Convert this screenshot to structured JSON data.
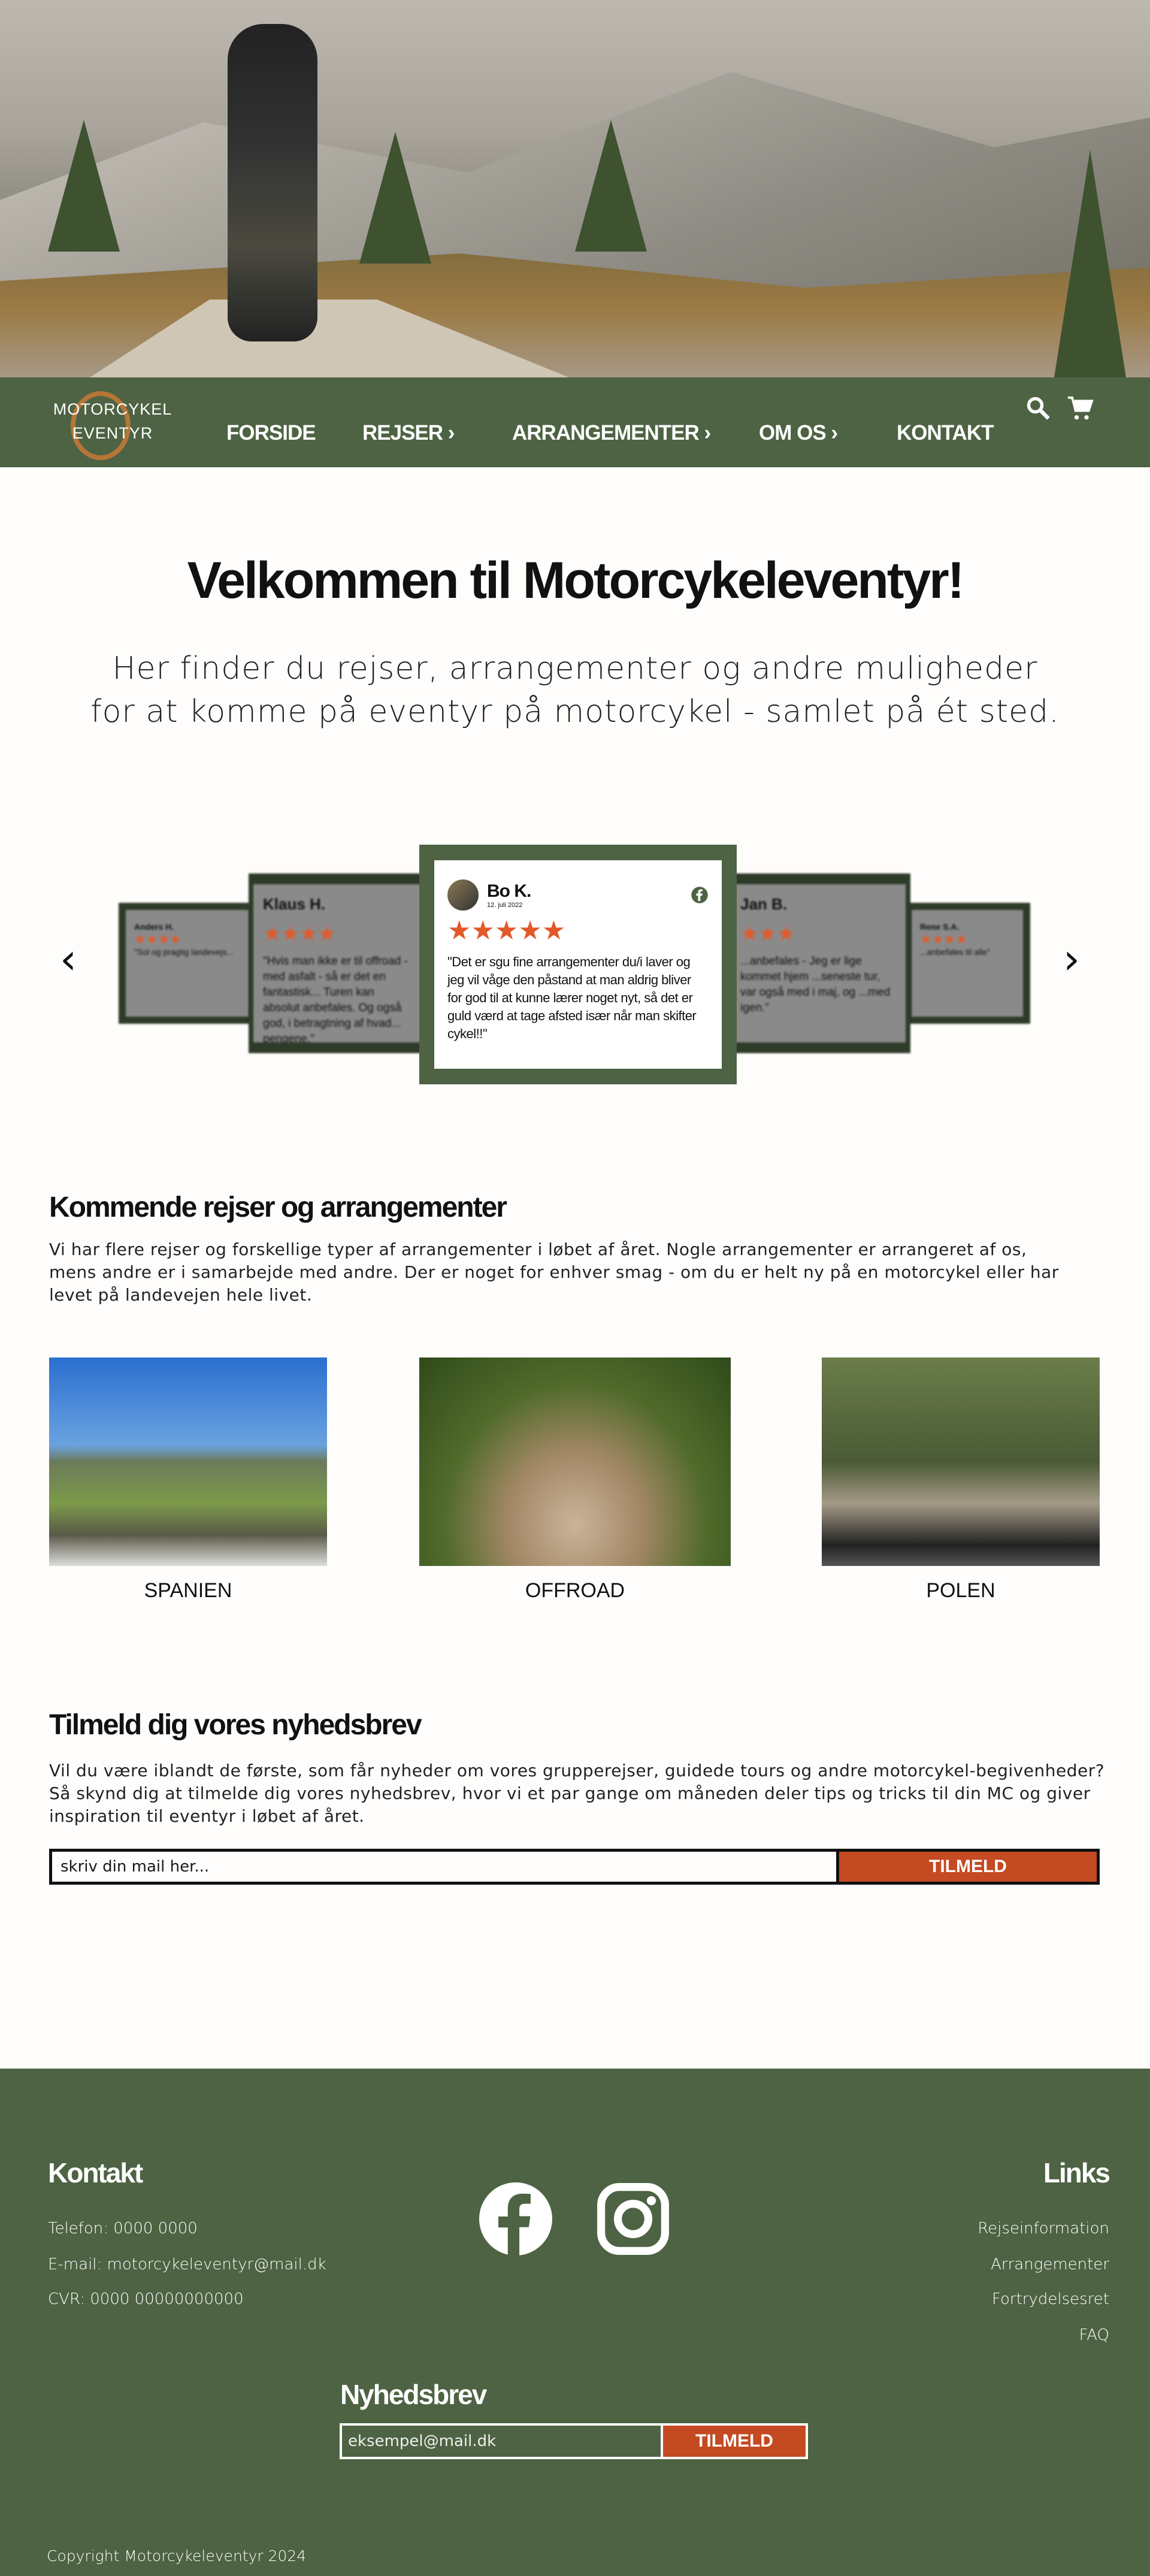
{
  "nav": {
    "logo_line1": "MOTORCYKEL",
    "logo_line2": "EVENTYR",
    "items": [
      {
        "label": "FORSIDE",
        "chevron": false
      },
      {
        "label": "REJSER",
        "chevron": true
      },
      {
        "label": "ARRANGEMENTER",
        "chevron": true
      },
      {
        "label": "OM OS",
        "chevron": true
      },
      {
        "label": "KONTAKT",
        "chevron": false
      }
    ],
    "icons": [
      "search-icon",
      "cart-icon"
    ]
  },
  "hero": {
    "title": "Velkommen til Motorcykeleventyr!",
    "subtitle_line1": "Her finder du rejser, arrangementer og andre muligheder",
    "subtitle_line2": "for at komme på eventyr på motorcykel - samlet på ét sted."
  },
  "reviews": [
    {
      "name": "Anders H.",
      "date": "",
      "stars": 4,
      "text": "\"Sol og pragtig landevejs..."
    },
    {
      "name": "Klaus H.",
      "date": "",
      "stars": 4,
      "text": "\"Hvis man ikke er til offroad - med asfalt - så er det en fantastisk... Turen kan absolut anbefales. Og også god, i betragtning af hvad... pengene.\""
    },
    {
      "name": "Bo K.",
      "date": "12. juli 2022",
      "stars": 5,
      "text": "\"Det er sgu fine arrangementer du/i laver og jeg vil våge den påstand at man aldrig bliver for god til at kunne lærer noget nyt, så det er guld værd at tage afsted især når man skifter cykel!!\""
    },
    {
      "name": "Jan B.",
      "date": "",
      "stars": 3,
      "text": "...anbefales - Jeg er lige kommet hjem ...seneste tur, var også med i maj, og ...med igen.\""
    },
    {
      "name": "Rene S.A.",
      "date": "",
      "stars": 4,
      "text": "...anbefales til alle\""
    }
  ],
  "upcoming": {
    "heading": "Kommende rejser og arrangementer",
    "text": "Vi har flere rejser og forskellige typer af arrangementer i løbet af året. Nogle arrangementer er arrangeret af os, mens andre er i samarbejde med andre. Der er noget for enhver smag - om du er helt ny på en motorcykel eller har levet på landevejen hele livet.",
    "destinations": [
      {
        "label": "SPANIEN"
      },
      {
        "label": "OFFROAD"
      },
      {
        "label": "POLEN"
      }
    ]
  },
  "newsletter": {
    "heading": "Tilmeld dig vores nyhedsbrev",
    "text": "Vil du være iblandt de første, som får nyheder om vores grupperejser, guidede tours og andre motorcykel-begivenheder? Så skynd dig at tilmelde dig vores nyhedsbrev, hvor vi et par gange om måneden deler tips og tricks til din MC og giver inspiration til eventyr i løbet af året.",
    "placeholder": "skriv din mail her...",
    "button": "TILMELD"
  },
  "footer": {
    "contact_heading": "Kontakt",
    "phone": "Telefon: 0000 0000",
    "email": "E-mail: motorcykeleventyr@mail.dk",
    "cvr": "CVR: 0000 00000000000",
    "links_heading": "Links",
    "links": [
      "Rejseinformation",
      "Arrangementer",
      "Fortrydelsesret",
      "FAQ"
    ],
    "newsletter_heading": "Nyhedsbrev",
    "newsletter_placeholder": "eksempel@mail.dk",
    "newsletter_button": "TILMELD",
    "copyright": "Copyright Motorcykeleventyr 2024",
    "social": [
      "facebook-icon",
      "instagram-icon"
    ]
  },
  "colors": {
    "green": "#4d6343",
    "accent": "#c44a22",
    "star": "#e2592a"
  }
}
